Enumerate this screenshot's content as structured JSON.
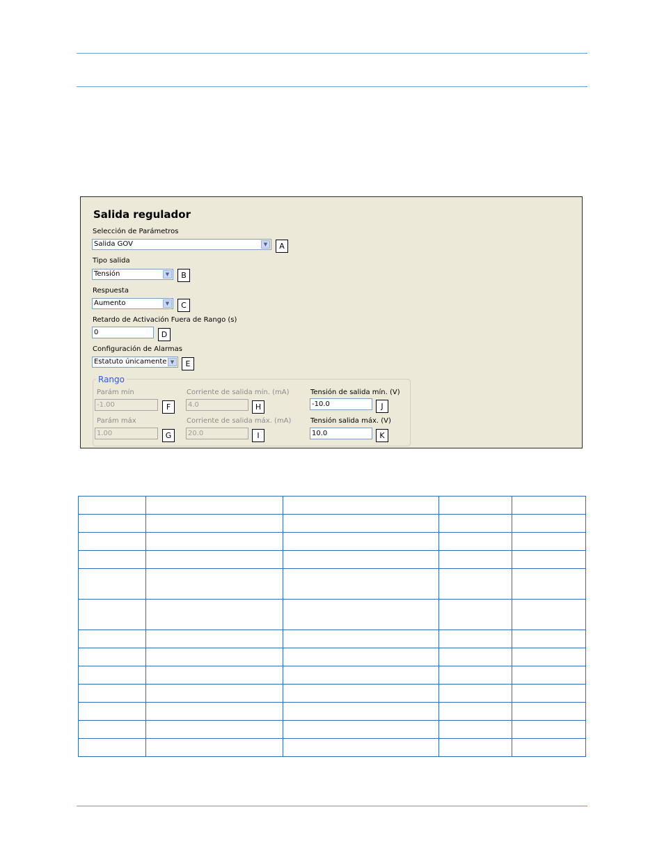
{
  "panel": {
    "title": "Salida regulador",
    "param_select": {
      "label": "Selección de Parámetros",
      "value": "Salida GOV",
      "callout": "A"
    },
    "output_type": {
      "label": "Tipo salida",
      "value": "Tensión",
      "callout": "B"
    },
    "response": {
      "label": "Respuesta",
      "value": "Aumento",
      "callout": "C"
    },
    "delay": {
      "label": "Retardo de Activación Fuera de Rango (s)",
      "value": "0",
      "callout": "D"
    },
    "alarms": {
      "label": "Configuración de Alarmas",
      "value": "Estatuto únicamente",
      "callout": "E"
    },
    "range": {
      "legend": "Rango",
      "param_min": {
        "label": "Parám mín",
        "value": "-1.00",
        "callout": "F"
      },
      "param_max": {
        "label": "Parám máx",
        "value": "1.00",
        "callout": "G"
      },
      "current_min": {
        "label": "Corriente de salida mín. (mA)",
        "value": "4.0",
        "callout": "H"
      },
      "current_max": {
        "label": "Corriente de salida máx. (mA)",
        "value": "20.0",
        "callout": "I"
      },
      "voltage_min": {
        "label": "Tensión de salida mín. (V)",
        "value": "-10.0",
        "callout": "J"
      },
      "voltage_max": {
        "label": "Tensión salida máx. (V)",
        "value": "10.0",
        "callout": "K"
      }
    }
  },
  "table": {
    "rows": [
      [
        "",
        "",
        "",
        "",
        ""
      ],
      [
        "",
        "",
        "",
        "",
        ""
      ],
      [
        "",
        "",
        "",
        "",
        ""
      ],
      [
        "",
        "",
        "",
        "",
        ""
      ],
      [
        "",
        "",
        "",
        "",
        ""
      ],
      [
        "",
        "",
        "",
        "",
        ""
      ],
      [
        "",
        "",
        "",
        "",
        ""
      ],
      [
        "",
        "",
        "",
        "",
        ""
      ],
      [
        "",
        "",
        "",
        "",
        ""
      ],
      [
        "",
        "",
        "",
        "",
        ""
      ],
      [
        "",
        "",
        "",
        "",
        ""
      ],
      [
        "",
        "",
        "",
        "",
        ""
      ],
      [
        "",
        "",
        "",
        "",
        ""
      ],
      [
        "",
        "",
        "",
        "",
        ""
      ],
      [
        "",
        "",
        "",
        "",
        ""
      ],
      [
        "",
        "",
        "",
        "",
        ""
      ]
    ]
  }
}
